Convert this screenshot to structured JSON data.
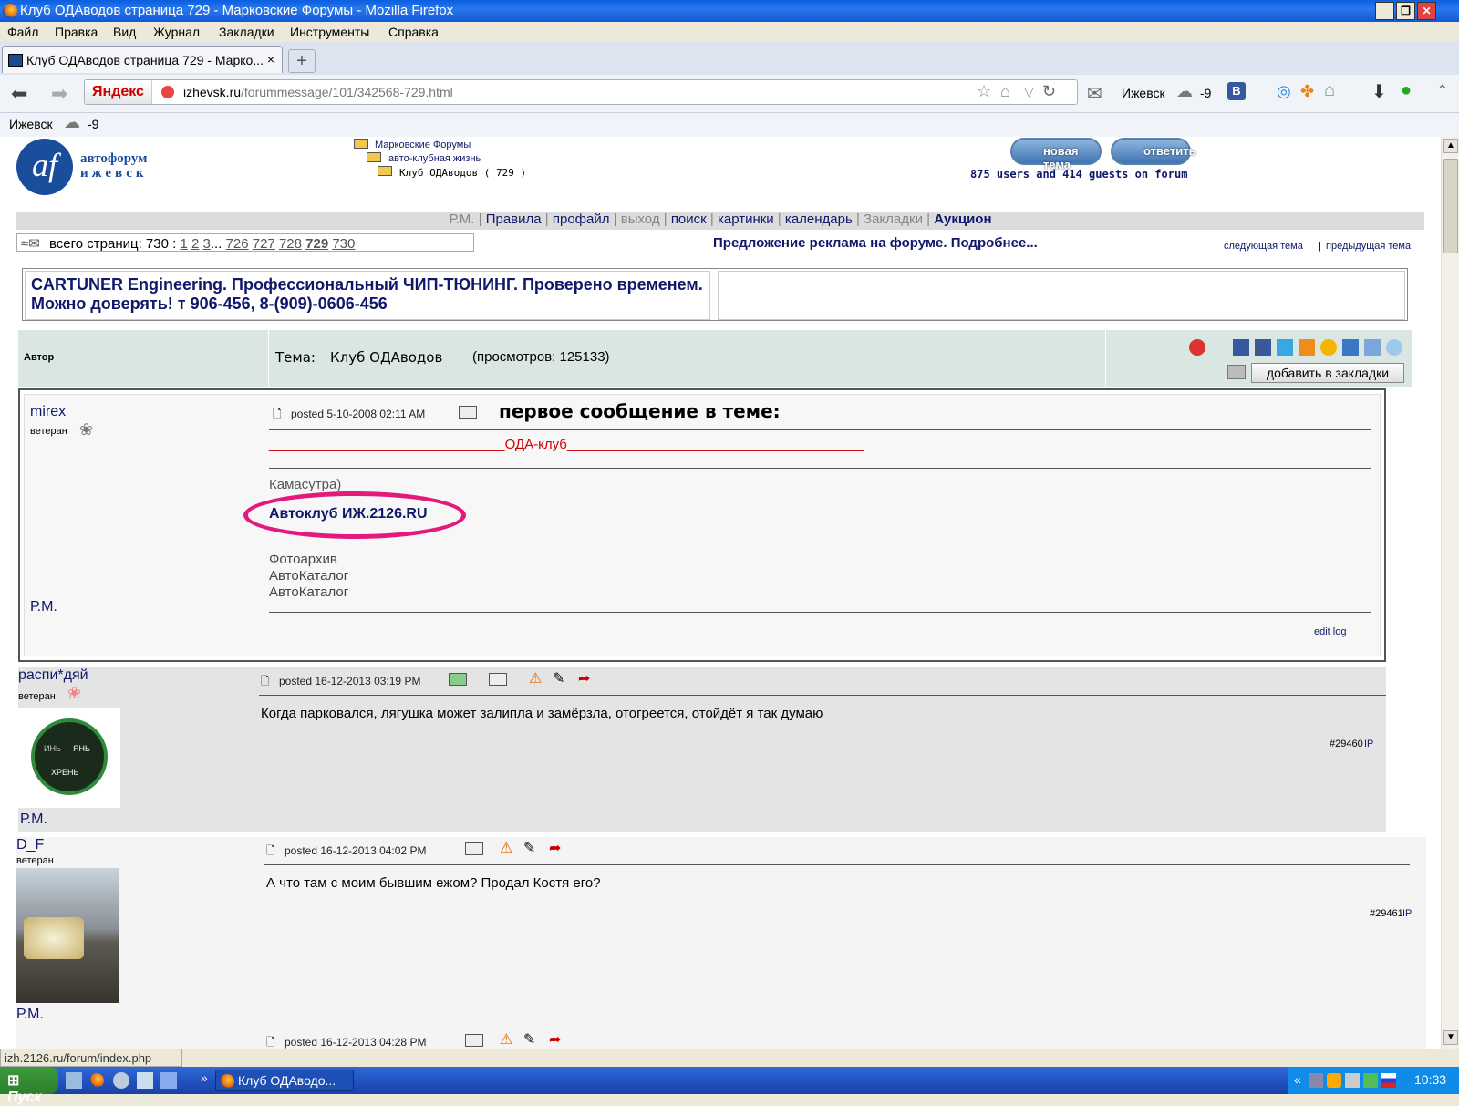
{
  "window": {
    "title": "Клуб ОДАводов страница 729 - Марковские Форумы - Mozilla Firefox",
    "controls": [
      "_",
      "❐",
      "✕"
    ]
  },
  "menubar": [
    "Файл",
    "Правка",
    "Вид",
    "Журнал",
    "Закладки",
    "Инструменты",
    "Справка"
  ],
  "tab": {
    "title": "Клуб ОДАводов страница 729 - Марко...",
    "close": "×",
    "new": "+"
  },
  "nav": {
    "yandex": "Яндекс",
    "url_host": "izhevsk.ru",
    "url_path": "/forummessage/101/342568-729.html",
    "weather_city": "Ижевск",
    "weather_temp": "-9"
  },
  "bookmarks": {
    "city": "Ижевск",
    "temp": "-9"
  },
  "site": {
    "logo_line1": "автофорум",
    "logo_line2": "ижевск",
    "breadcrumb": [
      "Марковские Форумы",
      "авто-клубная жизнь",
      "Клуб ОДАводов ( 729 )"
    ],
    "btn_new": "новая тема",
    "btn_reply": "ответить",
    "online": "875 users and 414 guests on forum",
    "menu": [
      "Р.М.",
      "Правила",
      "профайл",
      "выход",
      "поиск",
      "картинки",
      "календарь",
      "Закладки",
      "Аукцион"
    ],
    "pager_label": "всего страниц: 730 :",
    "pages": [
      "1",
      "2",
      "3",
      "...",
      "726",
      "727",
      "728",
      "729",
      "730"
    ],
    "current_page": "729",
    "ad_offer": "Предложение реклама на форуме. Подробнее...",
    "next_topic": "следующая тема",
    "prev_topic": "предыдущая тема",
    "ad_text": "CARTUNER Engineering. Профессиональный ЧИП-ТЮНИНГ. Проверено временем. Можно доверять! т 906-456, 8-(909)-0606-456"
  },
  "thread_header": {
    "author_col": "Автор",
    "topic_label": "Тема:",
    "topic": "Клуб ОДАводов",
    "views": "(просмотров: 125133)",
    "bookmark_btn": "добавить в закладки"
  },
  "posts": [
    {
      "author": "mirex",
      "rank": "ветеран",
      "posted": "posted 5-10-2008 02:11 AM",
      "first_msg": "первое сообщение в теме:",
      "banner_line": "_______________________________ОДА-клуб_______________________________________",
      "link1": "Камасутра)",
      "link2": "Автоклуб ИЖ.2126.RU",
      "link3": "Фотоархив",
      "link4": "АвтоКаталог",
      "link5": "АвтоКаталог",
      "pm": "Р.М.",
      "edit_log": "edit log"
    },
    {
      "author": "распи*дяй",
      "rank": "ветеран",
      "posted": "posted 16-12-2013 03:19 PM",
      "text": "Когда парковался, лягушка может залипла и замёрзла, отогреется, отойдёт я так думаю",
      "num": "#29460",
      "ip": "IP",
      "pm": "Р.М.",
      "avatar_top": "ИНЬ",
      "avatar_left": "ЯНЬ",
      "avatar_bottom": "ХРЕНЬ"
    },
    {
      "author": "D_F",
      "rank": "ветеран",
      "posted": "posted 16-12-2013 04:02 PM",
      "text": "А что там с моим бывшим ежом? Продал Костя его?",
      "num": "#29461",
      "ip": "IP",
      "pm": "Р.М."
    },
    {
      "posted": "posted 16-12-2013 04:28 PM"
    }
  ],
  "status": "izh.2126.ru/forum/index.php",
  "taskbar": {
    "start": "Пуск",
    "task": "Клуб ОДАводо...",
    "time": "10:33",
    "chevron": "»",
    "tray_chevron": "«"
  },
  "colors": {
    "highlight": "#e3197d",
    "red": "#d00000",
    "link": "#10186b"
  }
}
